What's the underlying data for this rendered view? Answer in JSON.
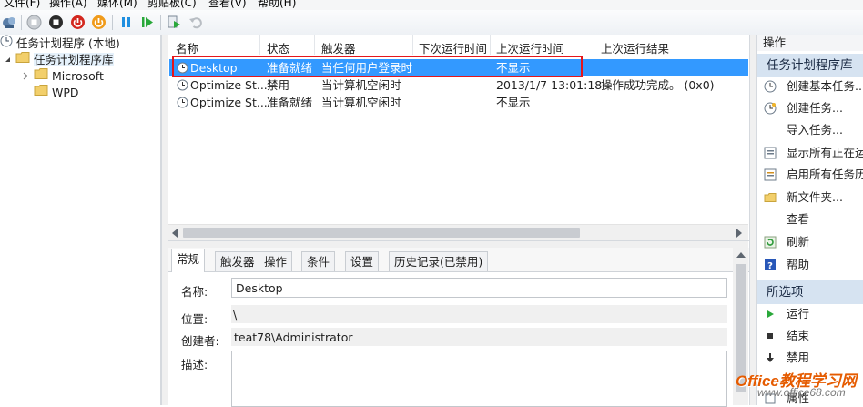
{
  "menubar": {
    "items": [
      "文件(F)",
      "操作(A)",
      "媒体(M)",
      "剪贴板(C)",
      "查看(V)",
      "帮助(H)"
    ]
  },
  "tree": {
    "root": "任务计划程序 (本地)",
    "library": "任务计划程序库",
    "children": [
      "Microsoft",
      "WPD"
    ]
  },
  "list": {
    "columns": [
      "名称",
      "状态",
      "触发器",
      "下次运行时间",
      "上次运行时间",
      "上次运行结果"
    ],
    "rows": [
      {
        "name": "Desktop",
        "status": "准备就绪",
        "trigger": "当任何用户登录时",
        "next_run": "",
        "last_run": "不显示",
        "last_result": ""
      },
      {
        "name": "Optimize St...",
        "status": "禁用",
        "trigger": "当计算机空闲时",
        "next_run": "",
        "last_run": "2013/1/7 13:01:18",
        "last_result": "操作成功完成。 (0x0)"
      },
      {
        "name": "Optimize St...",
        "status": "准备就绪",
        "trigger": "当计算机空闲时",
        "next_run": "",
        "last_run": "不显示",
        "last_result": ""
      }
    ]
  },
  "details": {
    "tabs": [
      "常规",
      "触发器",
      "操作",
      "条件",
      "设置",
      "历史记录(已禁用)"
    ],
    "name_label": "名称:",
    "name_value": "Desktop",
    "location_label": "位置:",
    "location_value": "\\",
    "author_label": "创建者:",
    "author_value": "teat78\\Administrator",
    "description_label": "描述:",
    "description_value": ""
  },
  "actions": {
    "header": "操作",
    "group1": "任务计划程序库",
    "group1_items": [
      {
        "label": "创建基本任务...",
        "icon": "create-basic-task-icon"
      },
      {
        "label": "创建任务...",
        "icon": "create-task-icon"
      },
      {
        "label": "导入任务...",
        "icon": "none"
      },
      {
        "label": "显示所有正在运行的任务",
        "icon": "running-tasks-icon"
      },
      {
        "label": "启用所有任务历史记录",
        "icon": "history-icon"
      },
      {
        "label": "新文件夹...",
        "icon": "new-folder-icon"
      },
      {
        "label": "查看",
        "icon": "none"
      },
      {
        "label": "刷新",
        "icon": "refresh-icon"
      },
      {
        "label": "帮助",
        "icon": "help-icon"
      }
    ],
    "group2": "所选项",
    "group2_items": [
      {
        "label": "运行",
        "icon": "run-icon"
      },
      {
        "label": "结束",
        "icon": "end-icon"
      },
      {
        "label": "禁用",
        "icon": "disable-icon"
      },
      {
        "label": "属性",
        "icon": "properties-icon"
      }
    ]
  },
  "watermark": {
    "line1": "Office教程学习网",
    "line2": "www.office68.com"
  },
  "colors": {
    "selection": "#3399ff",
    "highlight_box": "#e5161b",
    "action_group_bg": "#d6e3f1",
    "watermark": "#e55b00"
  }
}
